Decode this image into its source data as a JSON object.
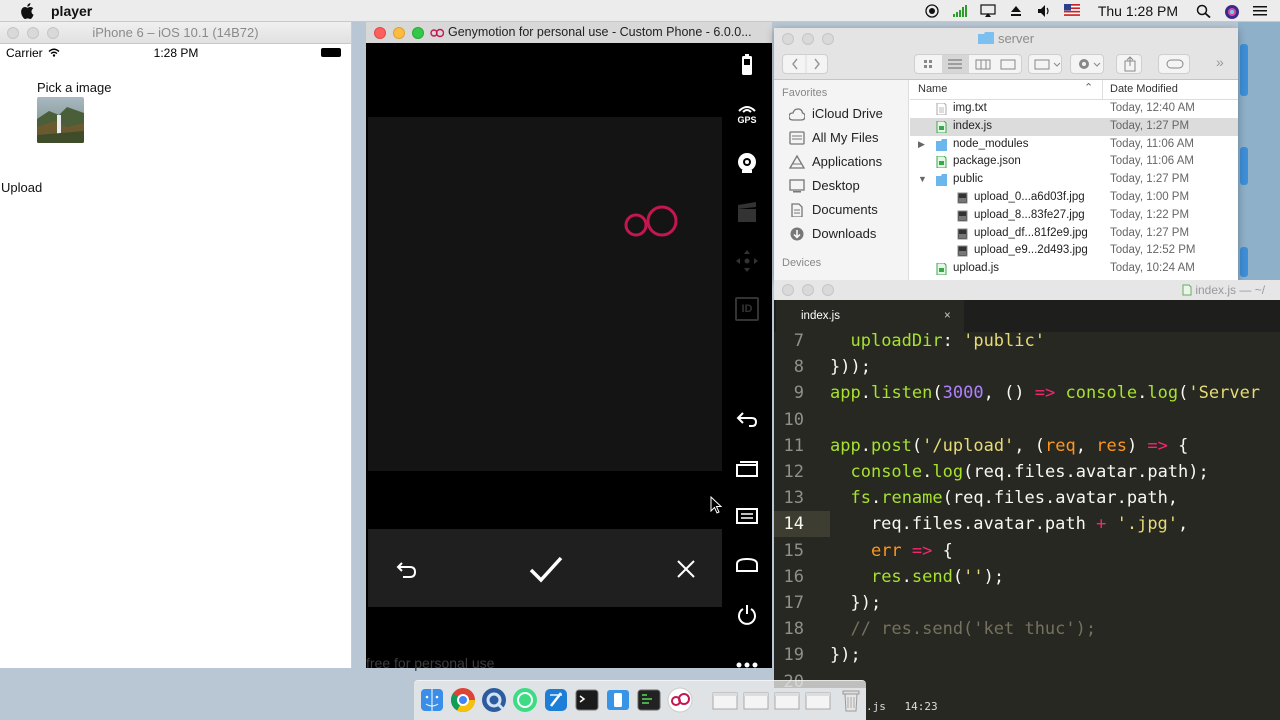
{
  "menubar": {
    "app_name": "player",
    "clock": "Thu 1:28 PM"
  },
  "simulator": {
    "window_title": "iPhone 6 – iOS 10.1 (14B72)",
    "carrier": "Carrier",
    "time": "1:28 PM",
    "pick_label": "Pick a image",
    "upload_label": "Upload"
  },
  "genymotion": {
    "window_title": "Genymotion for personal use - Custom Phone - 6.0.0...",
    "gps_label": "GPS",
    "id_label": "ID",
    "watermark": "free for personal use",
    "logo_text": "oO"
  },
  "finder": {
    "window_title": "server",
    "sidebar": {
      "favorites_header": "Favorites",
      "items": [
        {
          "label": "iCloud Drive",
          "icon": "cloud-icon"
        },
        {
          "label": "All My Files",
          "icon": "files-icon"
        },
        {
          "label": "Applications",
          "icon": "applications-icon"
        },
        {
          "label": "Desktop",
          "icon": "desktop-icon"
        },
        {
          "label": "Documents",
          "icon": "documents-icon"
        },
        {
          "label": "Downloads",
          "icon": "downloads-icon"
        }
      ],
      "devices_header": "Devices"
    },
    "columns": {
      "name": "Name",
      "date": "Date Modified"
    },
    "rows": [
      {
        "name": "img.txt",
        "date": "Today, 12:40 AM",
        "indent": 0,
        "kind": "text"
      },
      {
        "name": "index.js",
        "date": "Today, 1:27 PM",
        "indent": 0,
        "kind": "js",
        "selected": true
      },
      {
        "name": "node_modules",
        "date": "Today, 11:06 AM",
        "indent": 0,
        "kind": "folder",
        "disclosure": "▶"
      },
      {
        "name": "package.json",
        "date": "Today, 11:06 AM",
        "indent": 0,
        "kind": "js"
      },
      {
        "name": "public",
        "date": "Today, 1:27 PM",
        "indent": 0,
        "kind": "folder",
        "disclosure": "▼"
      },
      {
        "name": "upload_0...a6d03f.jpg",
        "date": "Today, 1:00 PM",
        "indent": 1,
        "kind": "image"
      },
      {
        "name": "upload_8...83fe27.jpg",
        "date": "Today, 1:22 PM",
        "indent": 1,
        "kind": "image"
      },
      {
        "name": "upload_df...81f2e9.jpg",
        "date": "Today, 1:27 PM",
        "indent": 1,
        "kind": "image"
      },
      {
        "name": "upload_e9...2d493.jpg",
        "date": "Today, 12:52 PM",
        "indent": 1,
        "kind": "image"
      },
      {
        "name": "upload.js",
        "date": "Today, 10:24 AM",
        "indent": 0,
        "kind": "js"
      }
    ]
  },
  "editor": {
    "window_title": "index.js — ~/",
    "tab_label": "index.js",
    "tab_close": "×",
    "current_line": 14,
    "line_numbers": [
      "7",
      "8",
      "9",
      "10",
      "11",
      "12",
      "13",
      "14",
      "15",
      "16",
      "17",
      "18",
      "19",
      "20"
    ],
    "lines": [
      [
        [
          "w",
          "  "
        ],
        [
          "k",
          "uploadDir"
        ],
        [
          "w",
          ": "
        ],
        [
          "s",
          "'public'"
        ]
      ],
      [
        [
          "w",
          "}));"
        ]
      ],
      [
        [
          "k",
          "app"
        ],
        [
          "w",
          "."
        ],
        [
          "k",
          "listen"
        ],
        [
          "w",
          "("
        ],
        [
          "n",
          "3000"
        ],
        [
          "w",
          ", () "
        ],
        [
          "o",
          "=>"
        ],
        [
          "w",
          " "
        ],
        [
          "k",
          "console"
        ],
        [
          "w",
          "."
        ],
        [
          "k",
          "log"
        ],
        [
          "w",
          "("
        ],
        [
          "s",
          "'Server"
        ]
      ],
      [],
      [
        [
          "k",
          "app"
        ],
        [
          "w",
          "."
        ],
        [
          "k",
          "post"
        ],
        [
          "w",
          "("
        ],
        [
          "s",
          "'/upload'"
        ],
        [
          "w",
          ", ("
        ],
        [
          "p",
          "req"
        ],
        [
          "w",
          ", "
        ],
        [
          "p",
          "res"
        ],
        [
          "w",
          ") "
        ],
        [
          "o",
          "=>"
        ],
        [
          "w",
          " {"
        ]
      ],
      [
        [
          "w",
          "  "
        ],
        [
          "k",
          "console"
        ],
        [
          "w",
          "."
        ],
        [
          "k",
          "log"
        ],
        [
          "w",
          "(req.files.avatar.path);"
        ]
      ],
      [
        [
          "w",
          "  "
        ],
        [
          "k",
          "fs"
        ],
        [
          "w",
          "."
        ],
        [
          "k",
          "rename"
        ],
        [
          "w",
          "(req.files.avatar.path,"
        ]
      ],
      [
        [
          "w",
          "    req.files.avatar.path "
        ],
        [
          "o",
          "+"
        ],
        [
          "w",
          " "
        ],
        [
          "s",
          "'.jpg'"
        ],
        [
          "w",
          ","
        ]
      ],
      [
        [
          "w",
          "    "
        ],
        [
          "p",
          "err"
        ],
        [
          "w",
          " "
        ],
        [
          "o",
          "=>"
        ],
        [
          "w",
          " {"
        ]
      ],
      [
        [
          "w",
          "    "
        ],
        [
          "k",
          "res"
        ],
        [
          "w",
          "."
        ],
        [
          "k",
          "send"
        ],
        [
          "w",
          "("
        ],
        [
          "s",
          "''"
        ],
        [
          "w",
          ");"
        ]
      ],
      [
        [
          "w",
          "  });"
        ]
      ],
      [
        [
          "c",
          "  // res.send('ket thuc');"
        ]
      ],
      [
        [
          "w",
          "});"
        ]
      ],
      []
    ],
    "status_file": ".js",
    "status_pos": "14:23"
  },
  "dock": {
    "apps": [
      "finder-icon",
      "chrome-icon",
      "quicktime-icon",
      "android-icon",
      "xcode-icon",
      "terminal-icon",
      "simulator-icon",
      "console-icon",
      "genymotion-icon",
      "window-icon",
      "window-icon",
      "window-icon",
      "window-icon",
      "trash-icon"
    ]
  }
}
